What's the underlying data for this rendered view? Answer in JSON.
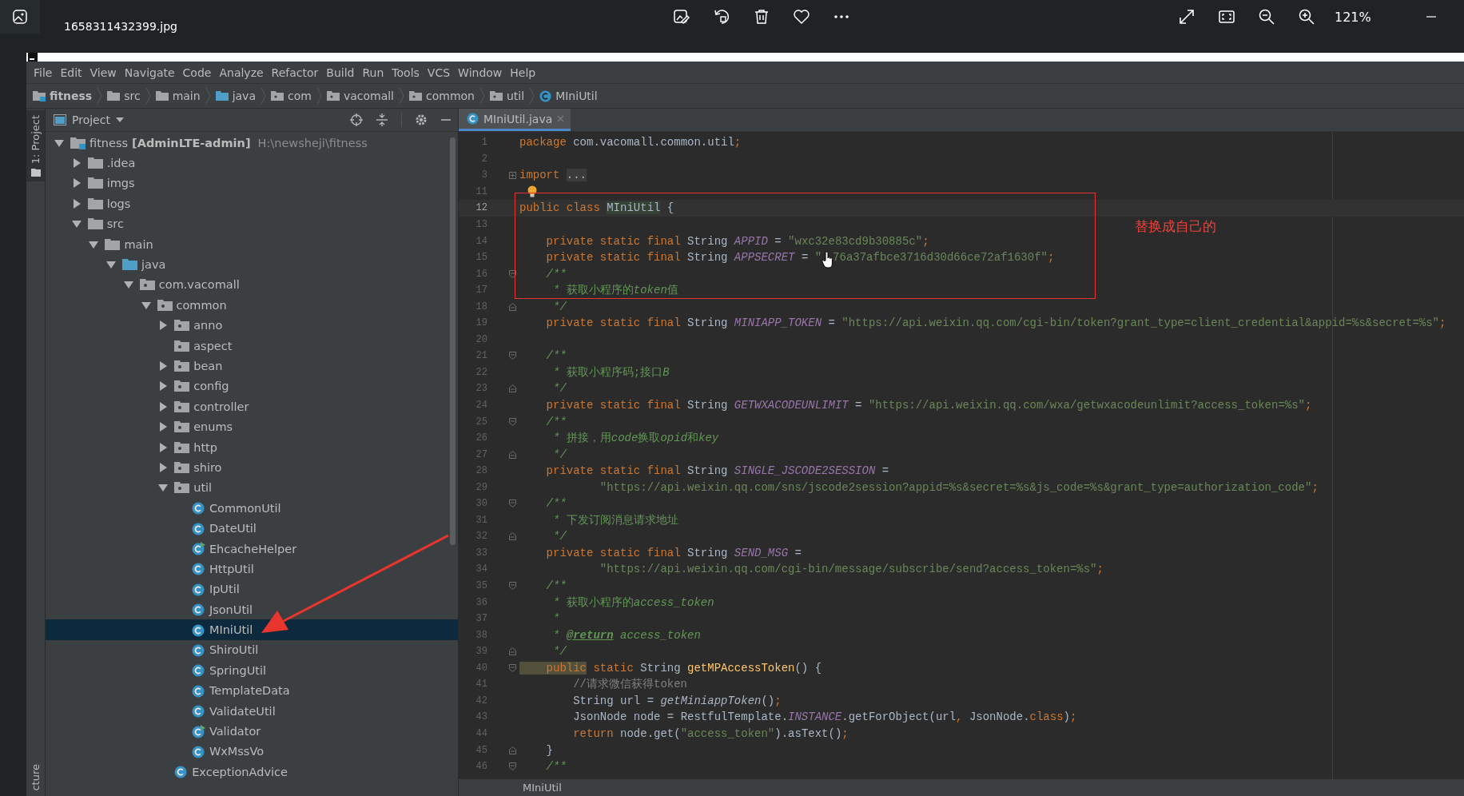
{
  "viewer": {
    "file_name": "1658311432399.jpg",
    "zoom": "121%"
  },
  "menu": [
    "File",
    "Edit",
    "View",
    "Navigate",
    "Code",
    "Analyze",
    "Refactor",
    "Build",
    "Run",
    "Tools",
    "VCS",
    "Window",
    "Help"
  ],
  "breadcrumb": [
    {
      "label": "fitness",
      "kind": "module"
    },
    {
      "label": "src",
      "kind": "folder"
    },
    {
      "label": "main",
      "kind": "folder"
    },
    {
      "label": "java",
      "kind": "source"
    },
    {
      "label": "com",
      "kind": "package"
    },
    {
      "label": "vacomall",
      "kind": "package"
    },
    {
      "label": "common",
      "kind": "package"
    },
    {
      "label": "util",
      "kind": "package"
    },
    {
      "label": "MIniUtil",
      "kind": "class"
    }
  ],
  "side_tabs": [
    {
      "label": "1: Project",
      "selected": true
    },
    {
      "label": "cture",
      "selected": false
    }
  ],
  "project": {
    "title": "Project",
    "tree": [
      {
        "label": "fitness",
        "module": "[AdminLTE-admin]",
        "path": "H:\\newsheji\\fitness",
        "kind": "module",
        "expanded": true,
        "selected": false,
        "children": [
          {
            "label": ".idea",
            "kind": "folder",
            "expanded": false,
            "selected": false
          },
          {
            "label": "imgs",
            "kind": "folder",
            "expanded": false,
            "selected": false
          },
          {
            "label": "logs",
            "kind": "folder",
            "expanded": false,
            "selected": false
          },
          {
            "label": "src",
            "kind": "folder",
            "expanded": true,
            "selected": false,
            "children": [
              {
                "label": "main",
                "kind": "folder",
                "expanded": true,
                "selected": false,
                "children": [
                  {
                    "label": "java",
                    "kind": "source",
                    "expanded": true,
                    "selected": false,
                    "children": [
                      {
                        "label": "com.vacomall",
                        "kind": "package",
                        "expanded": true,
                        "selected": false,
                        "children": [
                          {
                            "label": "common",
                            "kind": "package",
                            "expanded": true,
                            "selected": false,
                            "children": [
                              {
                                "label": "anno",
                                "kind": "package",
                                "expanded": false,
                                "selected": false
                              },
                              {
                                "label": "aspect",
                                "kind": "package",
                                "selected": false
                              },
                              {
                                "label": "bean",
                                "kind": "package",
                                "expanded": false,
                                "selected": false
                              },
                              {
                                "label": "config",
                                "kind": "package",
                                "expanded": false,
                                "selected": false
                              },
                              {
                                "label": "controller",
                                "kind": "package",
                                "expanded": false,
                                "selected": false
                              },
                              {
                                "label": "enums",
                                "kind": "package",
                                "expanded": false,
                                "selected": false
                              },
                              {
                                "label": "http",
                                "kind": "package",
                                "expanded": false,
                                "selected": false
                              },
                              {
                                "label": "shiro",
                                "kind": "package",
                                "expanded": false,
                                "selected": false
                              },
                              {
                                "label": "util",
                                "kind": "package",
                                "expanded": true,
                                "selected": false,
                                "children": [
                                  {
                                    "label": "CommonUtil",
                                    "kind": "class",
                                    "selected": false
                                  },
                                  {
                                    "label": "DateUtil",
                                    "kind": "class",
                                    "selected": false
                                  },
                                  {
                                    "label": "EhcacheHelper",
                                    "kind": "class-main",
                                    "selected": false
                                  },
                                  {
                                    "label": "HttpUtil",
                                    "kind": "class",
                                    "selected": false
                                  },
                                  {
                                    "label": "IpUtil",
                                    "kind": "class",
                                    "selected": false
                                  },
                                  {
                                    "label": "JsonUtil",
                                    "kind": "class",
                                    "selected": false
                                  },
                                  {
                                    "label": "MIniUtil",
                                    "kind": "class",
                                    "selected": true
                                  },
                                  {
                                    "label": "ShiroUtil",
                                    "kind": "class",
                                    "selected": false
                                  },
                                  {
                                    "label": "SpringUtil",
                                    "kind": "class",
                                    "selected": false
                                  },
                                  {
                                    "label": "TemplateData",
                                    "kind": "class",
                                    "selected": false
                                  },
                                  {
                                    "label": "ValidateUtil",
                                    "kind": "class",
                                    "selected": false
                                  },
                                  {
                                    "label": "Validator",
                                    "kind": "class-main",
                                    "selected": false
                                  },
                                  {
                                    "label": "WxMssVo",
                                    "kind": "class",
                                    "selected": false
                                  }
                                ]
                              },
                              {
                                "label": "ExceptionAdvice",
                                "kind": "class",
                                "selected": false
                              }
                            ]
                          }
                        ]
                      }
                    ]
                  }
                ]
              }
            ]
          }
        ]
      }
    ]
  },
  "editor": {
    "tabs": [
      {
        "label": "MIniUtil.java",
        "selected": true
      }
    ],
    "lines": [
      {
        "num": "1",
        "selected": false,
        "tokens": [
          {
            "kind": "kw",
            "text": "package"
          },
          {
            "kind": "plain",
            "text": " com.vacomall.common.util"
          },
          {
            "kind": "kw",
            "text": ";"
          }
        ]
      },
      {
        "num": "2",
        "selected": false
      },
      {
        "num": "3",
        "selected": false,
        "fold": {
          "kind": "expand"
        },
        "tokens": [
          {
            "kind": "kw",
            "text": "import "
          },
          {
            "kind": "folded",
            "text": "..."
          }
        ]
      },
      {
        "num": "11",
        "selected": false,
        "hint": {
          "kind": "bulb"
        }
      },
      {
        "num": "12",
        "selected": true,
        "tokens": [
          {
            "kind": "kw",
            "text": "public class "
          },
          {
            "kind": "decl",
            "text": "MIniUtil"
          },
          {
            "kind": "plain",
            "text": " {"
          }
        ]
      },
      {
        "num": "13",
        "selected": false
      },
      {
        "num": "14",
        "selected": false,
        "tokens": [
          {
            "kind": "kw",
            "text": "    private static final "
          },
          {
            "kind": "plain",
            "text": "String "
          },
          {
            "kind": "const",
            "text": "APPID"
          },
          {
            "kind": "plain",
            "text": " = "
          },
          {
            "kind": "str",
            "text": "\"wxc32e83cd9b30885c\""
          },
          {
            "kind": "kw",
            "text": ";"
          }
        ]
      },
      {
        "num": "15",
        "selected": false,
        "tokens": [
          {
            "kind": "kw",
            "text": "    private static final "
          },
          {
            "kind": "plain",
            "text": "String "
          },
          {
            "kind": "const",
            "text": "APPSECRET"
          },
          {
            "kind": "plain",
            "text": " = "
          },
          {
            "kind": "str",
            "text": "\""
          },
          {
            "kind": "cursor"
          },
          {
            "kind": "str",
            "text": "76a37afbce3716d30d66ce72af1630f\""
          },
          {
            "kind": "kw",
            "text": ";"
          }
        ]
      },
      {
        "num": "16",
        "selected": false,
        "fold": {
          "kind": "open"
        },
        "tokens": [
          {
            "kind": "doc",
            "text": "    /**"
          }
        ]
      },
      {
        "num": "17",
        "selected": false,
        "tokens": [
          {
            "kind": "doc",
            "text": "     * "
          },
          {
            "kind": "cjk",
            "text": "获取小程序的"
          },
          {
            "kind": "doc",
            "text": "token"
          },
          {
            "kind": "cjk",
            "text": "值"
          }
        ]
      },
      {
        "num": "18",
        "selected": false,
        "fold": {
          "kind": "close"
        },
        "tokens": [
          {
            "kind": "doc",
            "text": "     */"
          }
        ]
      },
      {
        "num": "19",
        "selected": false,
        "tokens": [
          {
            "kind": "kw",
            "text": "    private static final "
          },
          {
            "kind": "plain",
            "text": "String "
          },
          {
            "kind": "const",
            "text": "MINIAPP_TOKEN"
          },
          {
            "kind": "plain",
            "text": " = "
          },
          {
            "kind": "str",
            "text": "\"https://api.weixin.qq.com/cgi-bin/token?grant_type=client_credential&appid=%s&secret=%s\""
          },
          {
            "kind": "kw",
            "text": ";"
          }
        ]
      },
      {
        "num": "20",
        "selected": false
      },
      {
        "num": "21",
        "selected": false,
        "fold": {
          "kind": "open"
        },
        "tokens": [
          {
            "kind": "doc",
            "text": "    /**"
          }
        ]
      },
      {
        "num": "22",
        "selected": false,
        "tokens": [
          {
            "kind": "doc",
            "text": "     * "
          },
          {
            "kind": "cjk",
            "text": "获取小程序码;接口"
          },
          {
            "kind": "doc",
            "text": "B"
          }
        ]
      },
      {
        "num": "23",
        "selected": false,
        "fold": {
          "kind": "close"
        },
        "tokens": [
          {
            "kind": "doc",
            "text": "     */"
          }
        ]
      },
      {
        "num": "24",
        "selected": false,
        "tokens": [
          {
            "kind": "kw",
            "text": "    private static final "
          },
          {
            "kind": "plain",
            "text": "String "
          },
          {
            "kind": "const",
            "text": "GETWXACODEUNLIMIT"
          },
          {
            "kind": "plain",
            "text": " = "
          },
          {
            "kind": "str",
            "text": "\"https://api.weixin.qq.com/wxa/getwxacodeunlimit?access_token=%s\""
          },
          {
            "kind": "kw",
            "text": ";"
          }
        ]
      },
      {
        "num": "25",
        "selected": false,
        "fold": {
          "kind": "open"
        },
        "tokens": [
          {
            "kind": "doc",
            "text": "    /**"
          }
        ]
      },
      {
        "num": "26",
        "selected": false,
        "tokens": [
          {
            "kind": "doc",
            "text": "     * "
          },
          {
            "kind": "cjk",
            "text": "拼接，用"
          },
          {
            "kind": "doc",
            "text": "code"
          },
          {
            "kind": "cjk",
            "text": "换取"
          },
          {
            "kind": "doc",
            "text": "opid"
          },
          {
            "kind": "cjk",
            "text": "和"
          },
          {
            "kind": "doc",
            "text": "key"
          }
        ]
      },
      {
        "num": "27",
        "selected": false,
        "fold": {
          "kind": "close"
        },
        "tokens": [
          {
            "kind": "doc",
            "text": "     */"
          }
        ]
      },
      {
        "num": "28",
        "selected": false,
        "tokens": [
          {
            "kind": "kw",
            "text": "    private static final "
          },
          {
            "kind": "plain",
            "text": "String "
          },
          {
            "kind": "const",
            "text": "SINGLE_JSCODE2SESSION"
          },
          {
            "kind": "plain",
            "text": " ="
          }
        ]
      },
      {
        "num": "29",
        "selected": false,
        "tokens": [
          {
            "kind": "str",
            "text": "            \"https://api.weixin.qq.com/sns/jscode2session?appid=%s&secret=%s&js_code=%s&grant_type=authorization_code\""
          },
          {
            "kind": "kw",
            "text": ";"
          }
        ]
      },
      {
        "num": "30",
        "selected": false,
        "fold": {
          "kind": "open"
        },
        "tokens": [
          {
            "kind": "doc",
            "text": "    /**"
          }
        ]
      },
      {
        "num": "31",
        "selected": false,
        "tokens": [
          {
            "kind": "doc",
            "text": "     * "
          },
          {
            "kind": "cjk",
            "text": "下发订阅消息请求地址"
          }
        ]
      },
      {
        "num": "32",
        "selected": false,
        "fold": {
          "kind": "close"
        },
        "tokens": [
          {
            "kind": "doc",
            "text": "     */"
          }
        ]
      },
      {
        "num": "33",
        "selected": false,
        "tokens": [
          {
            "kind": "kw",
            "text": "    private static final "
          },
          {
            "kind": "plain",
            "text": "String "
          },
          {
            "kind": "const",
            "text": "SEND_MSG"
          },
          {
            "kind": "plain",
            "text": " ="
          }
        ]
      },
      {
        "num": "34",
        "selected": false,
        "tokens": [
          {
            "kind": "str",
            "text": "            \"https://api.weixin.qq.com/cgi-bin/message/subscribe/send?access_token=%s\""
          },
          {
            "kind": "kw",
            "text": ";"
          }
        ]
      },
      {
        "num": "35",
        "selected": false,
        "fold": {
          "kind": "open"
        },
        "tokens": [
          {
            "kind": "doc",
            "text": "    /**"
          }
        ]
      },
      {
        "num": "36",
        "selected": false,
        "tokens": [
          {
            "kind": "doc",
            "text": "     * "
          },
          {
            "kind": "cjk",
            "text": "获取小程序的"
          },
          {
            "kind": "doc",
            "text": "access_token"
          }
        ]
      },
      {
        "num": "37",
        "selected": false,
        "tokens": [
          {
            "kind": "doc",
            "text": "     *"
          }
        ]
      },
      {
        "num": "38",
        "selected": false,
        "tokens": [
          {
            "kind": "doc",
            "text": "     * "
          },
          {
            "kind": "doctag",
            "text": "@return"
          },
          {
            "kind": "doc",
            "text": " access_token"
          }
        ]
      },
      {
        "num": "39",
        "selected": false,
        "fold": {
          "kind": "close"
        },
        "tokens": [
          {
            "kind": "doc",
            "text": "     */"
          }
        ]
      },
      {
        "num": "40",
        "selected": false,
        "fold": {
          "kind": "open"
        },
        "tokens": [
          {
            "kind": "kw-hl",
            "text": "    public"
          },
          {
            "kind": "kw",
            "text": " static "
          },
          {
            "kind": "plain",
            "text": "String "
          },
          {
            "kind": "method",
            "text": "getMPAccessToken"
          },
          {
            "kind": "plain",
            "text": "() {"
          }
        ]
      },
      {
        "num": "41",
        "selected": false,
        "tokens": [
          {
            "kind": "comment",
            "text": "        //请求微信获得token"
          }
        ]
      },
      {
        "num": "42",
        "selected": false,
        "tokens": [
          {
            "kind": "plain",
            "text": "        String url = "
          },
          {
            "kind": "call",
            "text": "getMiniappToken"
          },
          {
            "kind": "plain",
            "text": "()"
          },
          {
            "kind": "kw",
            "text": ";"
          }
        ]
      },
      {
        "num": "43",
        "selected": false,
        "tokens": [
          {
            "kind": "plain",
            "text": "        JsonNode node = RestfulTemplate."
          },
          {
            "kind": "const",
            "text": "INSTANCE"
          },
          {
            "kind": "plain",
            "text": ".getForObject(url"
          },
          {
            "kind": "kw",
            "text": ","
          },
          {
            "kind": "plain",
            "text": " JsonNode."
          },
          {
            "kind": "kw",
            "text": "class"
          },
          {
            "kind": "plain",
            "text": ")"
          },
          {
            "kind": "kw",
            "text": ";"
          }
        ]
      },
      {
        "num": "44",
        "selected": false,
        "tokens": [
          {
            "kind": "kw",
            "text": "        return "
          },
          {
            "kind": "plain",
            "text": "node.get("
          },
          {
            "kind": "str",
            "text": "\"access_token\""
          },
          {
            "kind": "plain",
            "text": ").asText()"
          },
          {
            "kind": "kw",
            "text": ";"
          }
        ]
      },
      {
        "num": "45",
        "selected": false,
        "fold": {
          "kind": "close"
        },
        "tokens": [
          {
            "kind": "plain",
            "text": "    }"
          }
        ]
      },
      {
        "num": "46",
        "selected": false,
        "fold": {
          "kind": "open"
        },
        "tokens": [
          {
            "kind": "doc",
            "text": "    /**"
          }
        ]
      }
    ],
    "footer": "MIniUtil"
  },
  "annotation": {
    "note": "替换成自己的"
  }
}
